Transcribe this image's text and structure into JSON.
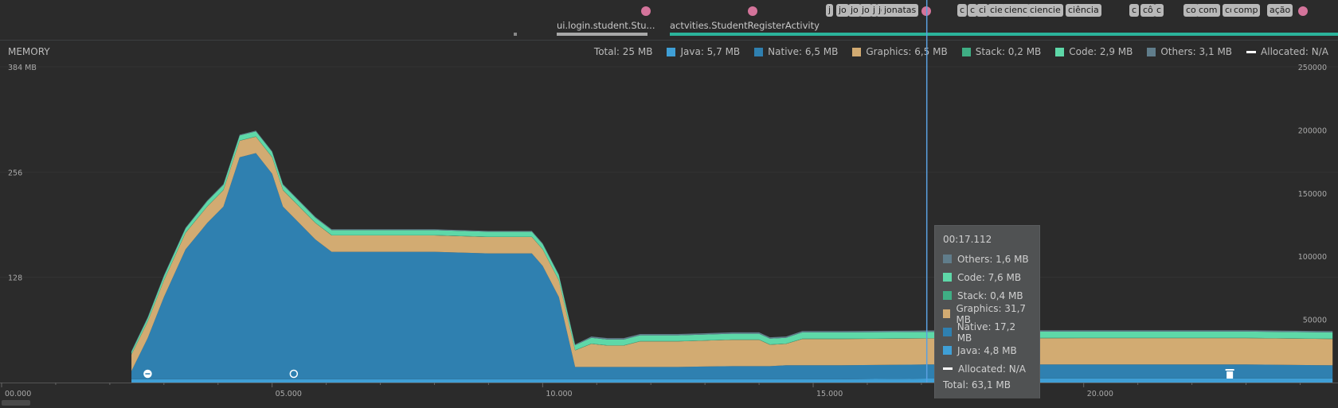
{
  "events": {
    "activities": [
      {
        "label": "ui.login.student.Stu...",
        "color": "#a9a9a9"
      },
      {
        "label": "actvities.StudentRegisterActivity",
        "color": "#2bb39b"
      }
    ],
    "chips": [
      "j",
      "jo",
      "jo",
      "jo",
      "j",
      "jo",
      "jonatas",
      "c",
      "c",
      "ci",
      "cie",
      "cienc",
      "ciencie",
      "ciência",
      "c",
      "cô",
      "c",
      "co",
      "com",
      "co",
      "comp",
      "ação"
    ]
  },
  "memory": {
    "title": "MEMORY",
    "legend": [
      {
        "label": "Total: 25 MB",
        "color": null
      },
      {
        "label": "Java: 5,7 MB",
        "color": "#3f9fd6"
      },
      {
        "label": "Native: 6,5 MB",
        "color": "#2f80b0"
      },
      {
        "label": "Graphics: 6,5 MB",
        "color": "#d2ab72"
      },
      {
        "label": "Stack: 0,2 MB",
        "color": "#3fae84"
      },
      {
        "label": "Code: 2,9 MB",
        "color": "#5ed8a8"
      },
      {
        "label": "Others: 3,1 MB",
        "color": "#607d8b"
      },
      {
        "label": "Allocated: N/A",
        "color": "dashed"
      }
    ]
  },
  "chart_data": {
    "type": "area",
    "title": "MEMORY",
    "y_left_ticks": [
      "384 MB",
      "256",
      "128"
    ],
    "y_right_ticks": [
      "250000",
      "200000",
      "150000",
      "100000",
      "50000"
    ],
    "x_ticks": [
      "00.000",
      "05.000",
      "10.000",
      "15.000",
      "20.000"
    ],
    "ylim_mb": [
      0,
      384
    ],
    "xlim_s": [
      0,
      24.7
    ],
    "x": [
      2.4,
      2.7,
      3.0,
      3.4,
      3.8,
      4.1,
      4.4,
      4.7,
      5.0,
      5.2,
      5.5,
      5.8,
      6.1,
      7.0,
      8.0,
      9.0,
      9.8,
      10.0,
      10.3,
      10.6,
      10.9,
      11.2,
      11.5,
      11.8,
      12.5,
      13.5,
      14.0,
      14.2,
      14.5,
      14.8,
      15.5,
      17.1,
      20.0,
      23.0,
      24.6
    ],
    "series": [
      {
        "name": "Java",
        "values": [
          4,
          4,
          4,
          4,
          4,
          4,
          4,
          4,
          4,
          4,
          4,
          4,
          4,
          4,
          4,
          4,
          4,
          4,
          4,
          4,
          4,
          4,
          4,
          4,
          4,
          4,
          4,
          4,
          4,
          4,
          4,
          4.8,
          5,
          5,
          5
        ]
      },
      {
        "name": "Native",
        "values": [
          10,
          50,
          100,
          158,
          190,
          210,
          270,
          275,
          250,
          210,
          190,
          170,
          155,
          155,
          155,
          153,
          153,
          138,
          100,
          15,
          15,
          15,
          15,
          15,
          15,
          16,
          16,
          16,
          17,
          17,
          17,
          17.2,
          17,
          17,
          16
        ]
      },
      {
        "name": "Graphics",
        "values": [
          20,
          20,
          20,
          20,
          20,
          20,
          20,
          20,
          20,
          20,
          20,
          20,
          20,
          20,
          20,
          20,
          20,
          20,
          20,
          20,
          28,
          26,
          26,
          31,
          31,
          32,
          32,
          26,
          26,
          32,
          32,
          31.7,
          32,
          32,
          32
        ]
      },
      {
        "name": "Stack",
        "values": [
          0.4,
          0.4,
          0.4,
          0.4,
          0.4,
          0.4,
          0.4,
          0.4,
          0.4,
          0.4,
          0.4,
          0.4,
          0.4,
          0.4,
          0.4,
          0.4,
          0.4,
          0.4,
          0.4,
          0.4,
          0.4,
          0.4,
          0.4,
          0.4,
          0.4,
          0.4,
          0.4,
          0.4,
          0.4,
          0.4,
          0.4,
          0.4,
          0.4,
          0.4,
          0.4
        ]
      },
      {
        "name": "Code",
        "values": [
          3,
          4,
          5,
          5,
          6,
          6,
          6,
          6,
          6,
          6,
          6,
          6,
          6,
          6,
          6,
          6,
          6,
          6,
          6,
          6,
          7,
          7,
          7,
          7,
          7,
          7,
          7,
          7,
          7,
          7.6,
          7.6,
          7.6,
          7.6,
          7.6,
          7.6
        ]
      },
      {
        "name": "Others",
        "values": [
          1,
          1,
          1,
          1,
          1,
          1,
          1,
          1,
          1,
          1,
          1,
          1,
          1,
          1,
          1,
          1,
          1,
          1,
          1,
          1,
          1.6,
          1.6,
          1.6,
          1.6,
          1.6,
          1.6,
          1.6,
          1.6,
          1.6,
          1.6,
          1.6,
          1.6,
          1.6,
          1.6,
          1.6
        ]
      }
    ],
    "gc_markers_s": [
      2.7,
      5.4
    ],
    "trash_marker_s": 22.7,
    "cursor_s": 17.1
  },
  "tooltip": {
    "time": "00:17.112",
    "rows": [
      {
        "label": "Others: 1,6 MB",
        "color": "#607d8b"
      },
      {
        "label": "Code: 7,6 MB",
        "color": "#5ed8a8"
      },
      {
        "label": "Stack: 0,4 MB",
        "color": "#3fae84"
      },
      {
        "label": "Graphics: 31,7 MB",
        "color": "#d2ab72"
      },
      {
        "label": "Native: 17,2 MB",
        "color": "#2f80b0"
      },
      {
        "label": "Java: 4,8 MB",
        "color": "#3f9fd6"
      },
      {
        "label": "Allocated: N/A",
        "color": "dashed"
      }
    ],
    "total": "Total: 63,1 MB"
  }
}
